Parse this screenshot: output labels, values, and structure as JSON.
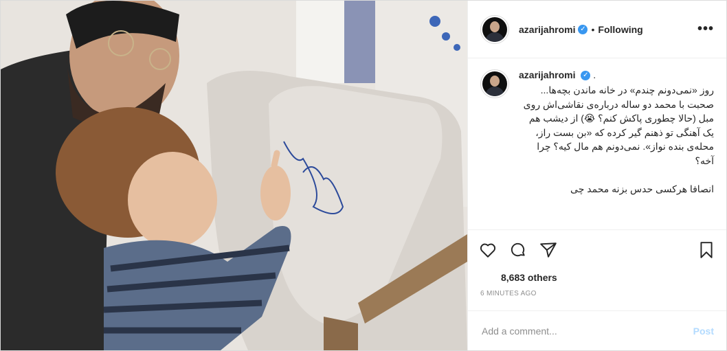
{
  "photo": {
    "alt_description": ""
  },
  "header": {
    "username": "azarijahromi",
    "separator": "•",
    "follow_status": "Following",
    "more_label": "•••"
  },
  "caption": {
    "username": "azarijahromi",
    "trailing": ".",
    "text": "روز «نمی‌دونم چندم» در خانه ماندن بچه‌ها... صحبت با محمد دو ساله درباره‌ی نقاشی‌اش روی مبل (حالا چطوری پاکش کنم؟ 😭) از دیشب هم یک آهنگی تو ذهنم گیر کرده که «بن بست راز، محله‌ی بنده نواز». نمی‌دونم هم مال کیه؟ چرا آخه؟\n\nانصافا هرکسی حدس بزنه محمد چی"
  },
  "actions": {
    "like_icon": "heart-icon",
    "comment_icon": "comment-icon",
    "share_icon": "paper-plane-icon",
    "save_icon": "bookmark-icon"
  },
  "likes": {
    "text": "8,683 others"
  },
  "timestamp": "6 MINUTES AGO",
  "comment_box": {
    "placeholder": "Add a comment...",
    "post_label": "Post"
  },
  "colors": {
    "verified": "#3897f0",
    "post_disabled": "#b3dbff",
    "muted": "#8e8e8e"
  }
}
